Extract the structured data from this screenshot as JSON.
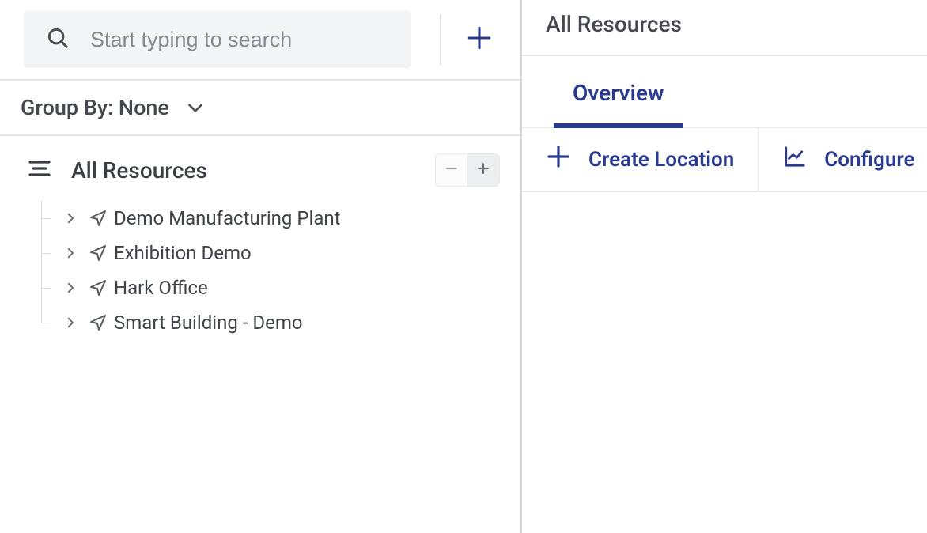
{
  "search": {
    "placeholder": "Start typing to search"
  },
  "groupby": {
    "label": "Group By: None"
  },
  "tree": {
    "title": "All Resources",
    "items": [
      {
        "label": "Demo Manufacturing Plant"
      },
      {
        "label": "Exhibition Demo"
      },
      {
        "label": "Hark Office"
      },
      {
        "label": "Smart Building - Demo"
      }
    ]
  },
  "right": {
    "header": "All Resources",
    "tabs": [
      {
        "label": "Overview",
        "active": true
      }
    ],
    "actions": [
      {
        "label": "Create Location",
        "icon": "plus"
      },
      {
        "label": "Configure",
        "icon": "chart"
      }
    ]
  },
  "colors": {
    "accent": "#2a3a8f"
  }
}
